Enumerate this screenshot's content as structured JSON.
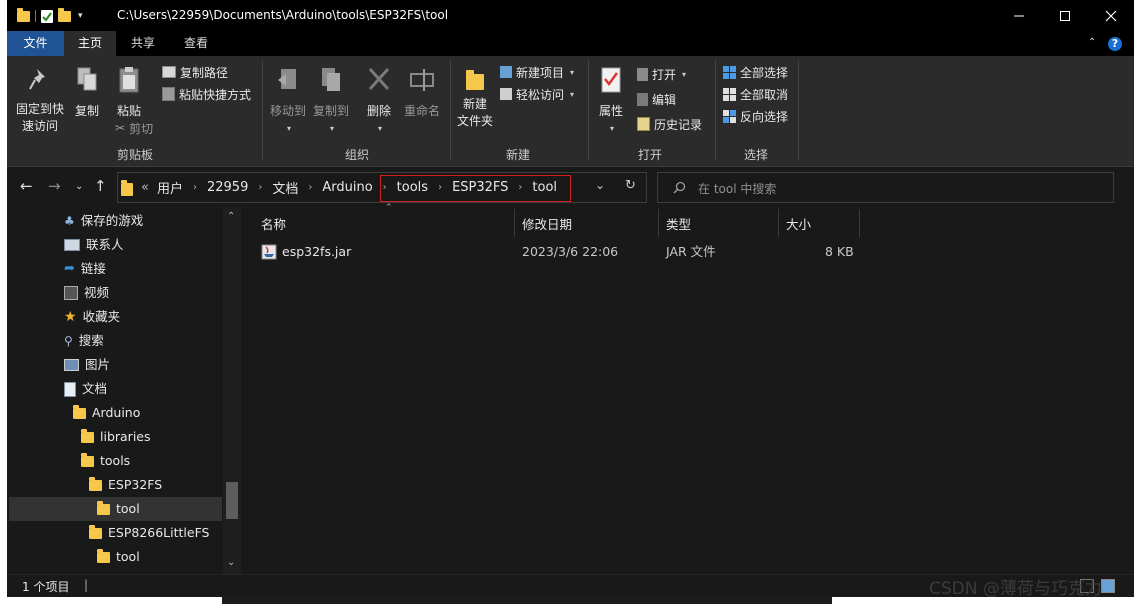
{
  "window": {
    "title": "C:\\Users\\22959\\Documents\\Arduino\\tools\\ESP32FS\\tool",
    "controls": [
      "minimize",
      "maximize",
      "close"
    ]
  },
  "tabs": [
    {
      "label": "文件"
    },
    {
      "label": "主页"
    },
    {
      "label": "共享"
    },
    {
      "label": "查看"
    }
  ],
  "ribbon": {
    "clipboard": {
      "pin_label": "固定到快\n速访问",
      "copy_label": "复制",
      "paste_label": "粘贴",
      "copy_path_label": "复制路径",
      "paste_shortcut_label": "粘贴快捷方式",
      "cut_label": "剪切",
      "group_label": "剪贴板"
    },
    "organize": {
      "move_to_label": "移动到",
      "copy_to_label": "复制到",
      "delete_label": "删除",
      "rename_label": "重命名",
      "group_label": "组织"
    },
    "new": {
      "new_folder_label": "新建\n文件夹",
      "new_item_label": "新建项目",
      "easy_access_label": "轻松访问",
      "group_label": "新建"
    },
    "open": {
      "properties_label": "属性",
      "open_label": "打开",
      "edit_label": "编辑",
      "history_label": "历史记录",
      "group_label": "打开"
    },
    "select": {
      "select_all_label": "全部选择",
      "select_none_label": "全部取消",
      "invert_label": "反向选择",
      "group_label": "选择"
    }
  },
  "address": {
    "overflow": "«",
    "crumbs": [
      "用户",
      "22959",
      "文档",
      "Arduino",
      "tools",
      "ESP32FS",
      "tool"
    ],
    "search_placeholder": "在 tool 中搜索"
  },
  "nav_pane": {
    "items": [
      {
        "label": "保存的游戏",
        "icon": "saved-games-icon"
      },
      {
        "label": "联系人",
        "icon": "contacts-icon"
      },
      {
        "label": "链接",
        "icon": "links-icon"
      },
      {
        "label": "视频",
        "icon": "videos-icon"
      },
      {
        "label": "收藏夹",
        "icon": "favorites-star-icon"
      },
      {
        "label": "搜索",
        "icon": "search-icon"
      },
      {
        "label": "图片",
        "icon": "pictures-icon"
      },
      {
        "label": "文档",
        "icon": "documents-icon"
      },
      {
        "label": "Arduino",
        "icon": "folder-icon"
      },
      {
        "label": "libraries",
        "icon": "folder-icon"
      },
      {
        "label": "tools",
        "icon": "folder-icon"
      },
      {
        "label": "ESP32FS",
        "icon": "folder-icon"
      },
      {
        "label": "tool",
        "icon": "folder-icon",
        "selected": true
      },
      {
        "label": "ESP8266LittleFS",
        "icon": "folder-icon"
      },
      {
        "label": "tool",
        "icon": "folder-icon"
      }
    ]
  },
  "file_list": {
    "columns": [
      "名称",
      "修改日期",
      "类型",
      "大小"
    ],
    "rows": [
      {
        "name": "esp32fs.jar",
        "date": "2023/3/6 22:06",
        "type": "JAR 文件",
        "size": "8 KB"
      }
    ]
  },
  "status": {
    "count_text": "1 个项目"
  },
  "watermark": "CSDN @薄荷与巧克力",
  "colors": {
    "window_bg": "#191919",
    "ribbon_bg": "#2b2b2b",
    "file_tab": "#1f5396",
    "folder": "#f5c84c",
    "highlight_border": "#d01f1f"
  }
}
